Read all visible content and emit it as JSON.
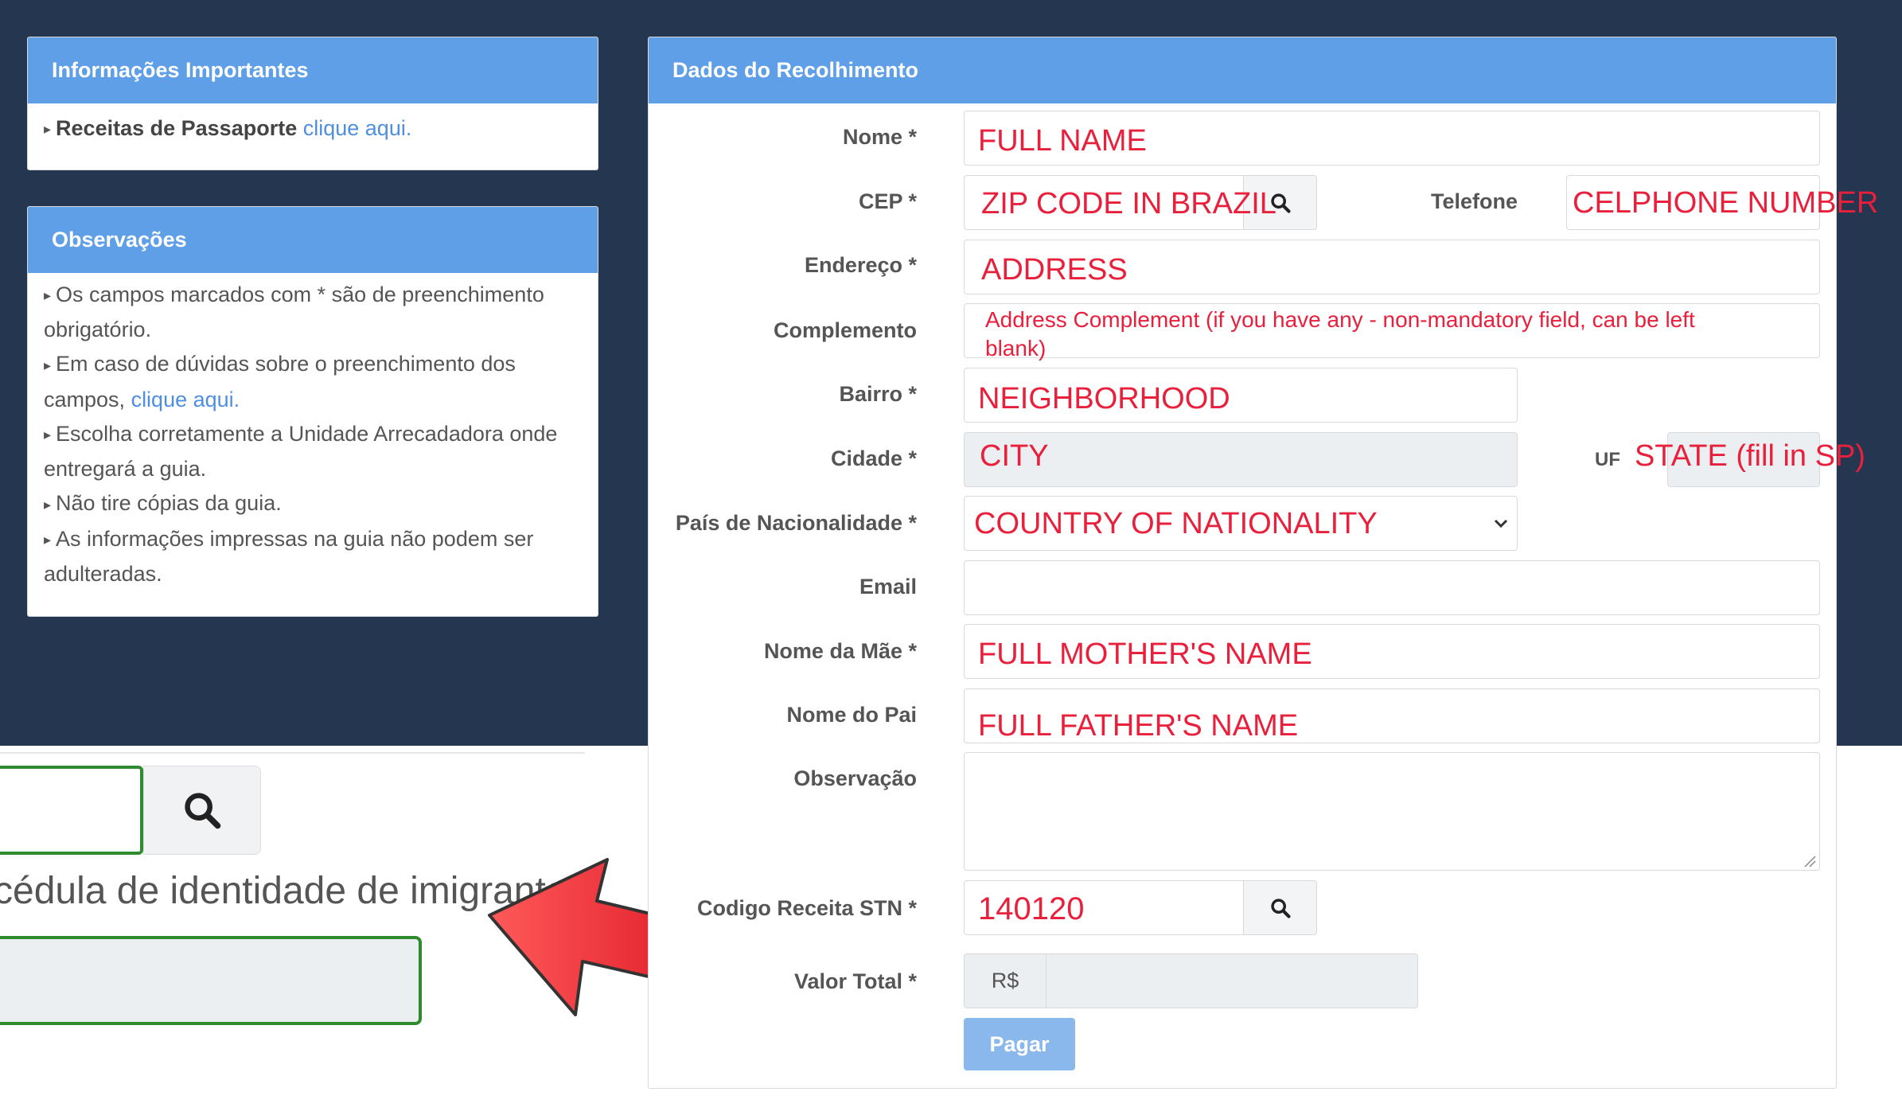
{
  "info_panel": {
    "title": "Informações Importantes",
    "line_bold": "Receitas de Passaporte",
    "line_link": "clique aqui."
  },
  "obs_panel": {
    "title": "Observações",
    "items": [
      "Os campos marcados com * são de preenchimento obrigatório.",
      "Em caso de dúvidas sobre o preenchimento dos campos,",
      "Escolha corretamente a Unidade Arrecadadora onde entregará a guia.",
      "Não tire cópias da guia.",
      "As informações impressas na guia não podem ser adulteradas."
    ],
    "link": "clique aqui."
  },
  "form_panel": {
    "title": "Dados do Recolhimento",
    "labels": {
      "nome": "Nome *",
      "cep": "CEP *",
      "telefone": "Telefone",
      "endereco": "Endereço *",
      "complemento": "Complemento",
      "bairro": "Bairro *",
      "cidade": "Cidade *",
      "uf": "UF",
      "pais": "País de Nacionalidade *",
      "email": "Email",
      "mae": "Nome da Mãe *",
      "pai": "Nome do Pai",
      "observacao": "Observação",
      "codigo": "Codigo Receita STN *",
      "valor": "Valor Total *"
    },
    "annotations": {
      "nome": "FULL NAME",
      "cep": "ZIP CODE IN BRAZIL",
      "telefone": "CELPHONE NUMBER",
      "endereco": "ADDRESS",
      "complemento_line1": "Address Complement (if you have any - non-mandatory field, can be left",
      "complemento_line2": "blank)",
      "bairro": "NEIGHBORHOOD",
      "cidade": "CITY",
      "uf": "STATE (fill in SP)",
      "pais": "COUNTRY OF NATIONALITY",
      "mae": "FULL MOTHER'S NAME",
      "pai": "FULL FATHER'S NAME",
      "codigo": "140120"
    },
    "currency": "R$",
    "submit_label": "Pagar"
  },
  "zoom_inset": {
    "text": "cédula de identidade de imigrante"
  },
  "colors": {
    "panel_header": "#5e9fe7",
    "annotation": "#e8203c",
    "arrow": "#e0182a",
    "highlight_border": "#2e8b2e"
  }
}
